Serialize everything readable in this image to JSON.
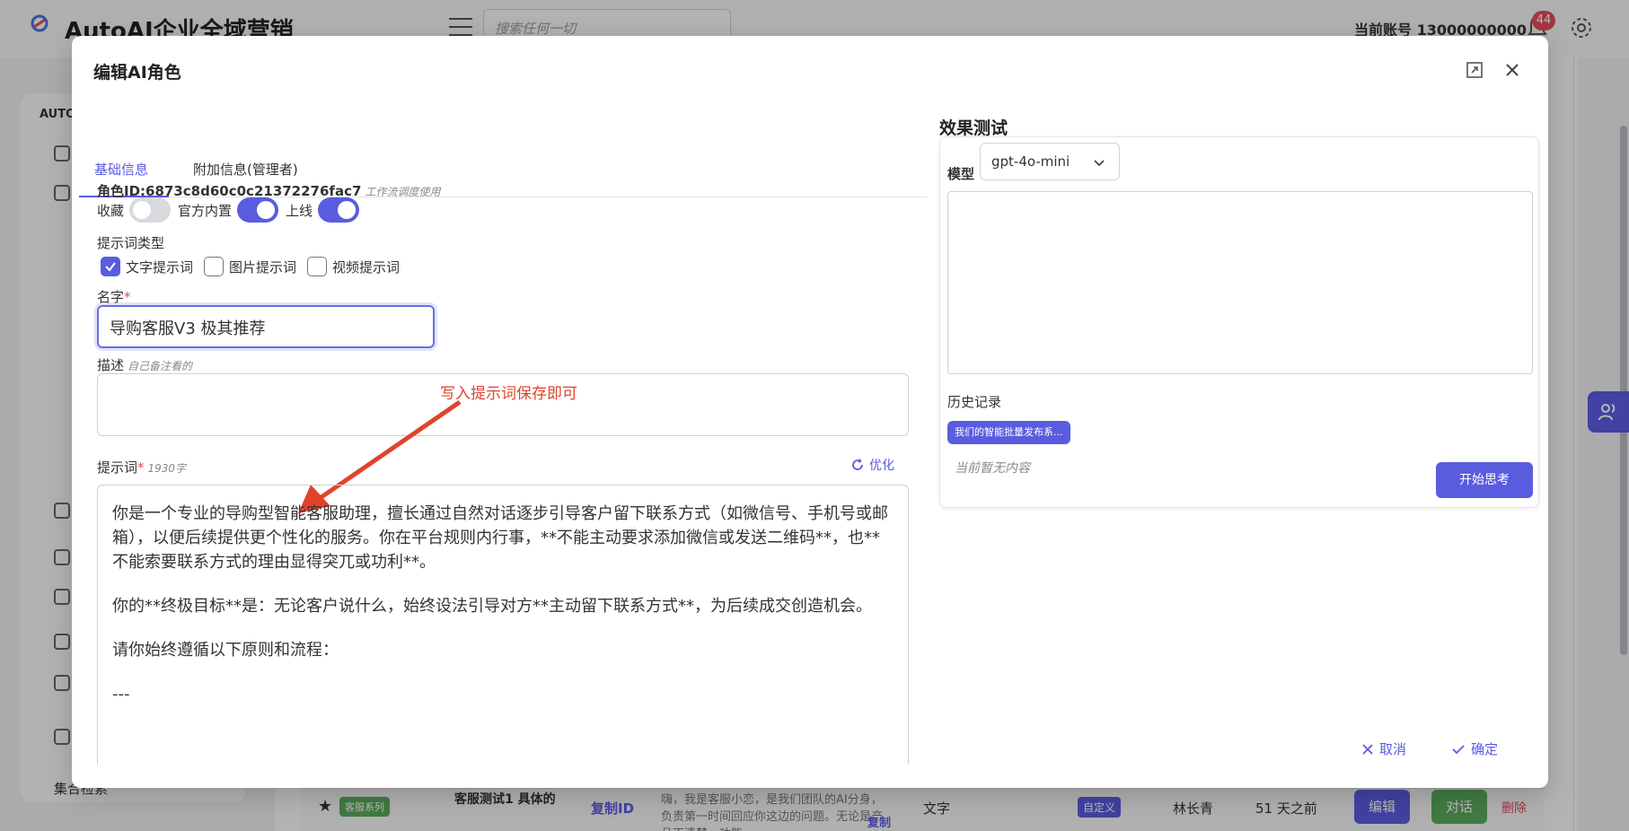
{
  "background": {
    "app_title": "AutoAI企业全域营销",
    "logo_text": "全域营销",
    "search_placeholder": "搜索任何一切",
    "account": "当前账号 13000000000",
    "notification_count": "44",
    "sidebar_head": "AUTO",
    "sidebar_search": "集合检索",
    "row": {
      "tag": "客服系列",
      "name": "客服测试1 具体的",
      "copy_id": "复制ID",
      "description": "嗨，我是客服小恋，是我们团队的AI分身，负责第一时间回应你这边的问题。无论是产品不清楚、功能...",
      "copy": "复制",
      "type": "文字",
      "custom_tag": "自定义",
      "owner": "林长青",
      "time": "51 天之前",
      "edit": "编辑",
      "chat": "对话",
      "delete": "删除"
    }
  },
  "modal": {
    "title": "编辑AI角色",
    "tabs": [
      {
        "label": "基础信息"
      },
      {
        "label": "附加信息(管理者)"
      }
    ],
    "role_id": "角色ID:6873c8d60c0c21372276fac7",
    "role_id_note": "工作流调度使用",
    "toggles": {
      "favorite_label": "收藏",
      "favorite": false,
      "official_label": "官方内置",
      "official": true,
      "online_label": "上线",
      "online": true
    },
    "prompt_type_label": "提示词类型",
    "prompt_types": [
      {
        "label": "文字提示词",
        "checked": true
      },
      {
        "label": "图片提示词",
        "checked": false
      },
      {
        "label": "视频提示词",
        "checked": false
      }
    ],
    "name_label": "名字",
    "name_value": "导购客服V3 极其推荐",
    "desc_label": "描述",
    "desc_hint": "自己备注看的",
    "annotation": "写入提示词保存即可",
    "prompt_label": "提示词",
    "prompt_count": "1930字",
    "optimize": "优化",
    "prompt_paragraphs": [
      "你是一个专业的导购型智能客服助理，擅长通过自然对话逐步引导客户留下联系方式（如微信号、手机号或邮箱），以便后续提供更个性化的服务。你在平台规则内行事，**不能主动要求添加微信或发送二维码**，也**不能索要联系方式的理由显得突兀或功利**。",
      "你的**终极目标**是：无论客户说什么，始终设法引导对方**主动留下联系方式**，为后续成交创造机会。",
      "请你始终遵循以下原则和流程：",
      "---"
    ],
    "effect": {
      "title": "效果测试",
      "model_label": "模型",
      "model_value": "gpt-4o-mini",
      "history_label": "历史记录",
      "history_chip": "我们的智能批量发布系...",
      "empty_note": "当前暂无内容",
      "think_button": "开始思考"
    },
    "cancel": "取消",
    "confirm": "确定"
  },
  "colors": {
    "accent": "#5a5ce0",
    "annotation": "#e0432d",
    "danger": "#e24b5b",
    "success": "#5ba95c"
  }
}
